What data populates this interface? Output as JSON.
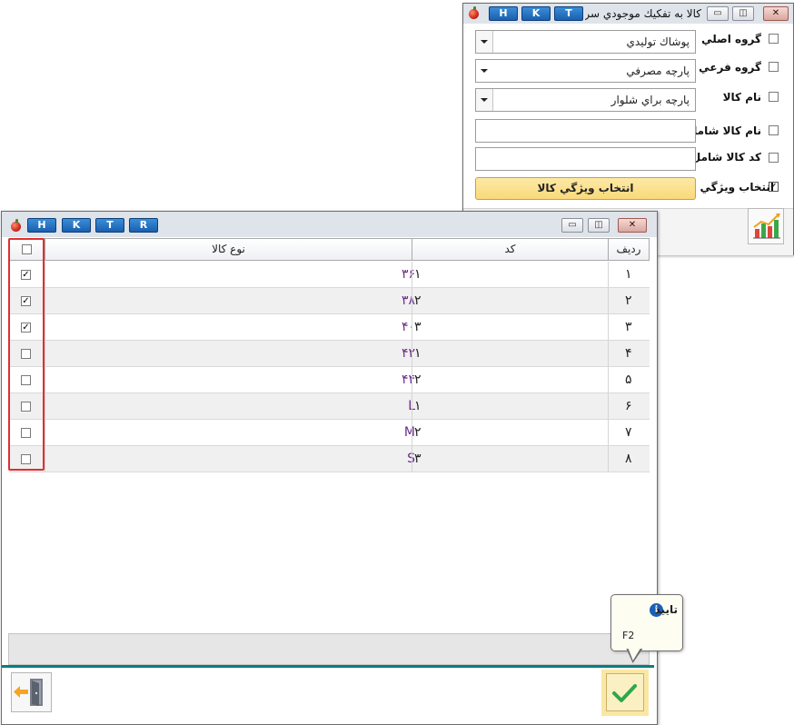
{
  "filter_window": {
    "title": "كالا به تفكيك موجودي سر",
    "keys": [
      "H",
      "K",
      "T"
    ],
    "controls": {
      "minimize": "▭",
      "restore": "◫",
      "close": "✕"
    },
    "rows": [
      {
        "label": "گروه اصلي",
        "checked": false,
        "value": "پوشاك توليدي",
        "type": "dropdown"
      },
      {
        "label": "گروه فرعي",
        "checked": false,
        "value": "پارچه مصرفي",
        "type": "dropdown"
      },
      {
        "label": "نام كالا",
        "checked": false,
        "value": "پارچه براي شلوار",
        "type": "dropdown"
      },
      {
        "label": "نام كالا شامل",
        "checked": false,
        "value": "",
        "type": "text"
      },
      {
        "label": "كد كالا شامل",
        "checked": false,
        "value": "",
        "type": "text"
      },
      {
        "label": "انتخاب ويژگي",
        "checked": true,
        "value": "انتخاب ويژگي كالا",
        "type": "button"
      }
    ],
    "chart_button_icon": "bar-chart-icon"
  },
  "select_window": {
    "keys": [
      "H",
      "K",
      "T",
      "R"
    ],
    "controls": {
      "minimize": "▭",
      "restore": "◫",
      "close": "✕"
    },
    "columns": {
      "select": "",
      "type": "نوع كالا",
      "code": "كد",
      "row": "رديف"
    },
    "rows": [
      {
        "row": "۱",
        "code": "۱",
        "type": "۳۶",
        "checked": true
      },
      {
        "row": "۲",
        "code": "۲",
        "type": "۳۸",
        "checked": true
      },
      {
        "row": "۳",
        "code": "۳",
        "type": "۴۰",
        "checked": true
      },
      {
        "row": "۴",
        "code": "۱",
        "type": "۴۲",
        "checked": false
      },
      {
        "row": "۵",
        "code": "۲",
        "type": "۴۴",
        "checked": false
      },
      {
        "row": "۶",
        "code": "۱",
        "type": "L",
        "checked": false
      },
      {
        "row": "۷",
        "code": "۲",
        "type": "M",
        "checked": false
      },
      {
        "row": "۸",
        "code": "۳",
        "type": "S",
        "checked": false
      }
    ],
    "tooltip": {
      "title": "تاييد",
      "shortcut": "F2"
    },
    "exit_icon": "exit-door-icon",
    "confirm_icon": "checkmark-icon",
    "colors": {
      "accent": "#008080",
      "type_text": "#6a2a8a",
      "highlight": "#e03030",
      "confirm_bg": "#fbe7a4"
    }
  }
}
